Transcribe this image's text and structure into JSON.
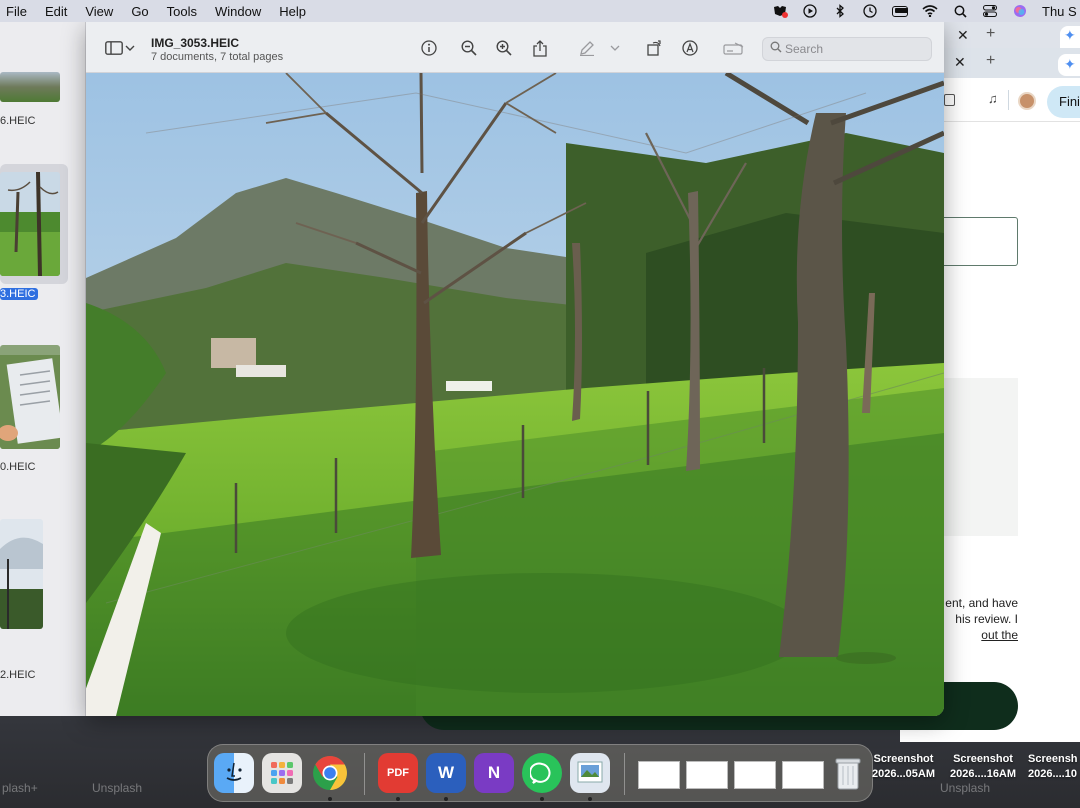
{
  "menubar": {
    "items": [
      "File",
      "Edit",
      "View",
      "Go",
      "Tools",
      "Window",
      "Help"
    ],
    "clock": "Thu S"
  },
  "browser": {
    "finish_label": "Finis",
    "body_text": [
      "ent, and have",
      "his review. I",
      "out the"
    ]
  },
  "sidebar": {
    "items": [
      {
        "label": "6.HEIC",
        "selected": false
      },
      {
        "label": "3.HEIC",
        "selected": true
      },
      {
        "label": "0.HEIC",
        "selected": false
      },
      {
        "label": "2.HEIC",
        "selected": false
      }
    ]
  },
  "preview": {
    "title": "IMG_3053.HEIC",
    "subtitle": "7 documents, 7 total pages",
    "search_placeholder": "Search",
    "icons": [
      "sidebar-toggle-icon",
      "info-icon",
      "zoom-out-icon",
      "zoom-in-icon",
      "share-icon",
      "markup-pen-icon",
      "rotate-icon",
      "annotate-icon",
      "signature-icon"
    ]
  },
  "dock": {
    "screenshots": [
      {
        "line1": "Screenshot",
        "line2": "2026...05AM"
      },
      {
        "line1": "Screenshot",
        "line2": "2026....16AM"
      },
      {
        "line1": "Screensh",
        "line2": "2026....10"
      }
    ],
    "wallpaper_labels": [
      "plash+",
      "Unsplash",
      "Unsplash"
    ]
  }
}
